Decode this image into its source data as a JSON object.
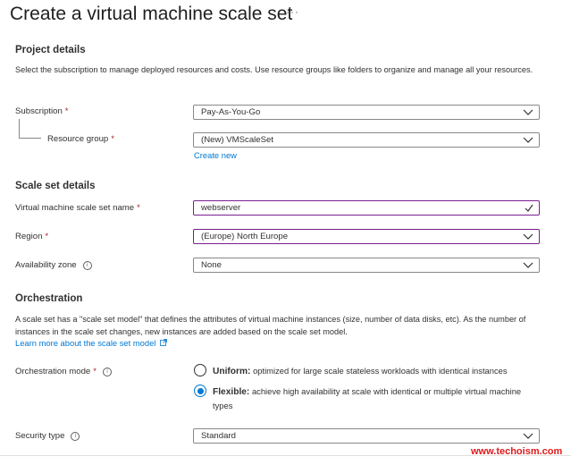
{
  "page": {
    "title": "Create a virtual machine scale set",
    "more_label": "···"
  },
  "project_details": {
    "heading": "Project details",
    "description": "Select the subscription to manage deployed resources and costs. Use resource groups like folders to organize and manage all your resources.",
    "subscription": {
      "label": "Subscription",
      "required": "*",
      "value": "Pay-As-You-Go"
    },
    "resource_group": {
      "label": "Resource group",
      "required": "*",
      "value": "(New) VMScaleSet",
      "create_new": "Create new"
    }
  },
  "scale_set_details": {
    "heading": "Scale set details",
    "name": {
      "label": "Virtual machine scale set name",
      "required": "*",
      "value": "webserver"
    },
    "region": {
      "label": "Region",
      "required": "*",
      "value": "(Europe) North Europe"
    },
    "availability_zone": {
      "label": "Availability zone",
      "info": "i",
      "value": "None"
    }
  },
  "orchestration": {
    "heading": "Orchestration",
    "description": "A scale set has a \"scale set model\" that defines the attributes of virtual machine instances (size, number of data disks, etc). As the number of instances in the scale set changes, new instances are added based on the scale set model.",
    "learn_more": "Learn more about the scale set model",
    "mode_label": "Orchestration mode",
    "mode_required": "*",
    "mode_info": "i",
    "options": [
      {
        "name": "Uniform:",
        "description": "optimized for large scale stateless workloads with identical instances",
        "selected": false
      },
      {
        "name": "Flexible:",
        "description": "achieve high availability at scale with identical or multiple virtual machine types",
        "selected": true
      }
    ],
    "security_type": {
      "label": "Security type",
      "info": "i",
      "value": "Standard"
    }
  },
  "watermark": "www.techoism.com",
  "colors": {
    "accent": "#0078d4",
    "focus_border": "#7a1f8f",
    "required": "#a4262c",
    "watermark": "#e0191b"
  },
  "icons": {
    "dropdown": "chevron-down-icon",
    "valid": "checkmark-icon",
    "info": "info-icon",
    "external": "external-link-icon"
  }
}
